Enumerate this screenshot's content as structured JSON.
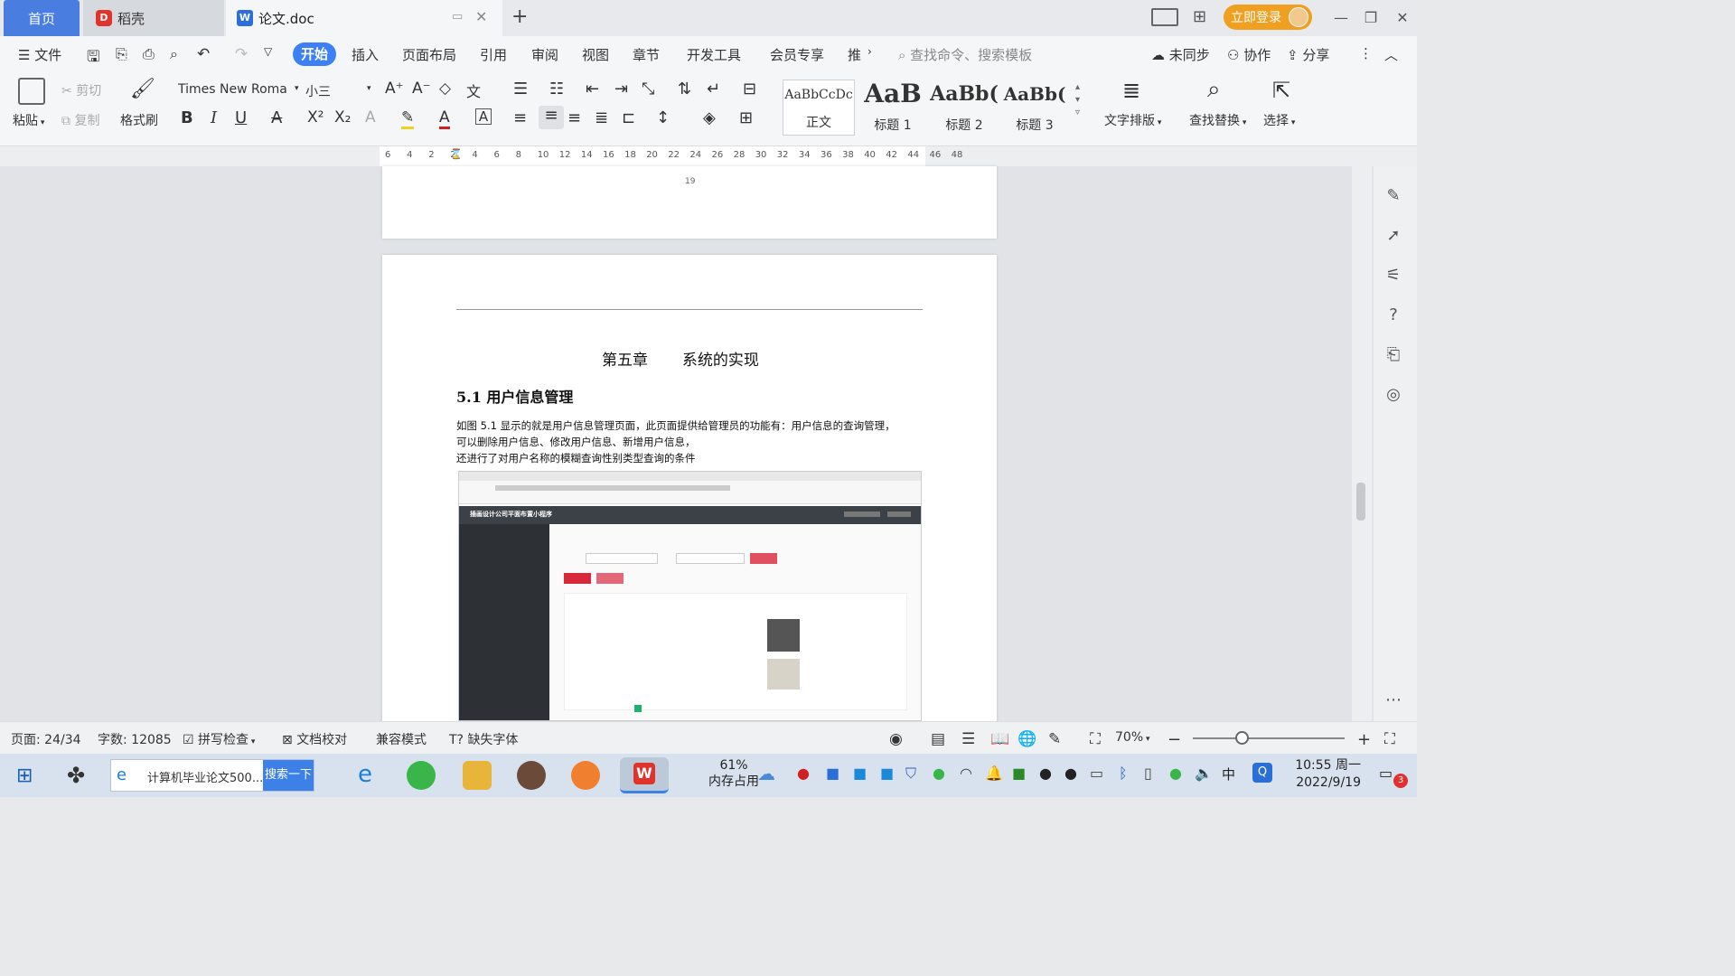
{
  "tabs": {
    "home": "首页",
    "daoke": "稻壳",
    "doc": "论文.doc"
  },
  "titlebar": {
    "login": "立即登录"
  },
  "menu": {
    "file": "文件",
    "items": [
      "开始",
      "插入",
      "页面布局",
      "引用",
      "审阅",
      "视图",
      "章节",
      "开发工具",
      "会员专享",
      "推"
    ],
    "search_placeholder": "查找命令、搜索模板",
    "unsync": "未同步",
    "collab": "协作",
    "share": "分享"
  },
  "ribbon": {
    "paste": "粘贴",
    "cut": "剪切",
    "copy": "复制",
    "format_painter": "格式刷",
    "font_name": "Times New Roma",
    "font_size": "小三",
    "styles": [
      {
        "preview": "AaBbCcDc",
        "label": "正文"
      },
      {
        "preview": "AaB",
        "label": "标题 1"
      },
      {
        "preview": "AaBb(",
        "label": "标题 2"
      },
      {
        "preview": "AaBb(",
        "label": "标题 3"
      }
    ],
    "text_layout": "文字排版",
    "find_replace": "查找替换",
    "select": "选择"
  },
  "ruler": {
    "ticks": [
      "6",
      "4",
      "2",
      "2",
      "4",
      "6",
      "8",
      "10",
      "12",
      "14",
      "16",
      "18",
      "20",
      "22",
      "24",
      "26",
      "28",
      "30",
      "32",
      "34",
      "36",
      "38",
      "40",
      "42",
      "44",
      "46",
      "48"
    ]
  },
  "document": {
    "page_number_top": "19",
    "chapter": "第五章       系统的实现",
    "section": "5.1 用户信息管理",
    "paragraph_lines": [
      "如图 5.1 显示的就是用户信息管理页面，此页面提供给管理员的功能有：用户信息的查询管理，",
      "可以删除用户信息、修改用户信息、新增用户信息，",
      "还进行了对用户名称的模糊查询性别类型查询的条件"
    ],
    "screenshot_title": "插画设计公司平面布置小程序"
  },
  "statusbar": {
    "page": "页面: 24/34",
    "words": "字数: 12085",
    "spellcheck": "拼写检查",
    "doc_check": "文档校对",
    "compat": "兼容模式",
    "missing_font": "缺失字体",
    "zoom": "70%"
  },
  "taskbar": {
    "browser_tab": "计算机毕业论文500...",
    "search_btn": "搜索一下",
    "memory_pct": "61%",
    "memory_label": "内存占用",
    "ime": "中",
    "time": "10:55 周一",
    "date": "2022/9/19",
    "notif_count": "3"
  }
}
